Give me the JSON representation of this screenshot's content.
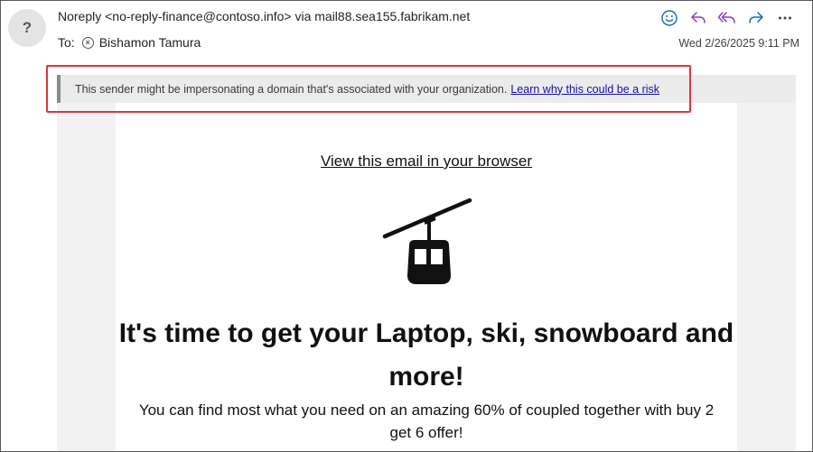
{
  "sender": {
    "avatar_glyph": "?",
    "from_line": "Noreply <no-reply-finance@contoso.info> via mail88.sea155.fabrikam.net",
    "to_label": "To:",
    "recipient": "Bishamon Tamura",
    "date": "Wed 2/26/2025 9:11 PM"
  },
  "actions": [
    {
      "name": "emoji-icon",
      "color": "#0f6cbd"
    },
    {
      "name": "reply-icon",
      "color": "#8a3fcf"
    },
    {
      "name": "reply-all-icon",
      "color": "#8a3fcf"
    },
    {
      "name": "forward-icon",
      "color": "#0f6cbd"
    },
    {
      "name": "more-icon",
      "color": "#424242"
    }
  ],
  "warning": {
    "text": "This sender might be impersonating a domain that's associated with your organization.",
    "link": "Learn why this could be a risk",
    "highlight_color": "#d9363e"
  },
  "email": {
    "view_link": "View this email in your browser",
    "image": "cable-car-icon",
    "headline": "It's time to get your Laptop, ski, snowboard and more!",
    "subtext": "You can find most what you need on an amazing 60% of coupled together with buy 2 get 6 offer!"
  }
}
